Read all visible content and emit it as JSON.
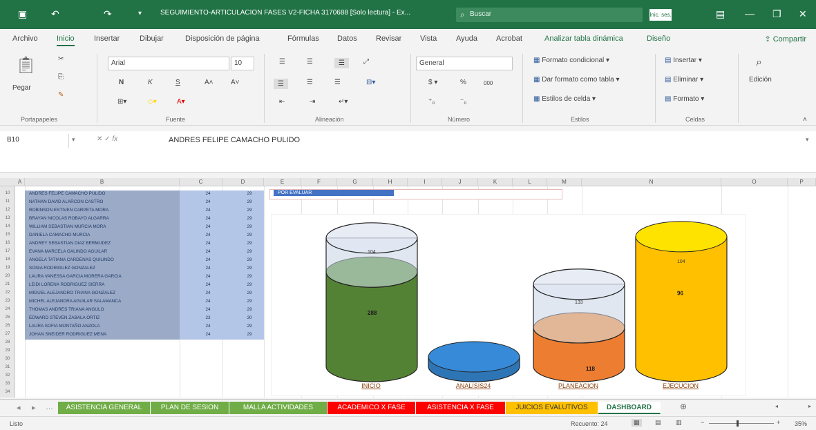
{
  "title_bar": {
    "doc_title": "SEGUIMIENTO-ARTICULACION FASES V2-FICHA 3170688 [Solo lectura] - Ex...",
    "search_placeholder": "Buscar",
    "signin": "Inic. ses."
  },
  "menu": [
    "Archivo",
    "Inicio",
    "Insertar",
    "Dibujar",
    "Disposición de página",
    "Fórmulas",
    "Datos",
    "Revisar",
    "Vista",
    "Ayuda",
    "Acrobat",
    "Analizar tabla dinámica",
    "Diseño"
  ],
  "share_label": "Compartir",
  "ribbon": {
    "clipboard": {
      "paste": "Pegar",
      "label": "Portapapeles"
    },
    "font": {
      "name": "Arial",
      "size": "10",
      "label": "Fuente"
    },
    "alignment": {
      "label": "Alineación"
    },
    "number": {
      "format": "General",
      "label": "Número"
    },
    "styles": {
      "conditional": "Formato condicional",
      "table": "Dar formato como tabla",
      "cell": "Estilos de celda",
      "label": "Estilos"
    },
    "cells": {
      "insert": "Insertar",
      "delete": "Eliminar",
      "format": "Formato",
      "label": "Celdas"
    },
    "editing": {
      "label": "Edición"
    }
  },
  "formula_bar": {
    "name_box": "B10",
    "value": "ANDRES FELIPE CAMACHO PULIDO"
  },
  "columns": [
    "A",
    "B",
    "C",
    "D",
    "E",
    "F",
    "G",
    "H",
    "I",
    "J",
    "K",
    "L",
    "M",
    "N",
    "O",
    "P"
  ],
  "row_numbers": [
    "10",
    "11",
    "12",
    "13",
    "14",
    "15",
    "16",
    "17",
    "18",
    "19",
    "20",
    "21",
    "22",
    "23",
    "24",
    "25",
    "26",
    "27",
    "28",
    "29",
    "30",
    "31",
    "32",
    "33",
    "34"
  ],
  "students": [
    {
      "name": "ANDRES FELIPE CAMACHO PULIDO",
      "c": "24",
      "d": "29"
    },
    {
      "name": "NATHAN DAVID ALARCON CASTRO",
      "c": "24",
      "d": "29"
    },
    {
      "name": "ROBINSON ESTIVEN CARPETA MORA",
      "c": "24",
      "d": "29"
    },
    {
      "name": "BRAYAN NICOLAS ROBAYO ALGARRA",
      "c": "24",
      "d": "29"
    },
    {
      "name": "WILLIAM SEBASTIAN MURCIA MORA",
      "c": "24",
      "d": "29"
    },
    {
      "name": "DANIELA CAMACHO MURCIA",
      "c": "24",
      "d": "29"
    },
    {
      "name": "ANDREY SEBASTIAN DIAZ BERMUDEZ",
      "c": "24",
      "d": "29"
    },
    {
      "name": "EVANA MARCELA GALINDO AGUILAR",
      "c": "24",
      "d": "29"
    },
    {
      "name": "ANGELA TATIANA CARDENAS QUILINDO",
      "c": "24",
      "d": "29"
    },
    {
      "name": "SONIA RODRIGUEZ GONZALEZ",
      "c": "24",
      "d": "29"
    },
    {
      "name": "LAURA VANESSA GARCIA MORERA GARCIA",
      "c": "24",
      "d": "29"
    },
    {
      "name": "LEIDI LORENA RODRIGUEZ SIERRA",
      "c": "24",
      "d": "29"
    },
    {
      "name": "MIGUEL ALEJANDRO TRIANA GONZALEZ",
      "c": "24",
      "d": "29"
    },
    {
      "name": "MICHEL ALEJANDRA AGUILAR SALAMANCA",
      "c": "24",
      "d": "29"
    },
    {
      "name": "THOMAS ANDRES TRIANA ANGULO",
      "c": "24",
      "d": "29"
    },
    {
      "name": "EDWARD STEVEN ZABALA ORTIZ",
      "c": "23",
      "d": "30"
    },
    {
      "name": "LAURA SOFIA MONTAÑO ANZOLA",
      "c": "24",
      "d": "29"
    },
    {
      "name": "JOHAN SNEIDER RODRIGUEZ MENA",
      "c": "24",
      "d": "29"
    }
  ],
  "pending_label": "POR EVALUAR",
  "chart_data": {
    "type": "bar",
    "style": "3d-cylinder",
    "categories": [
      "INICIO",
      "ANALISIS24",
      "PLANEACION",
      "EJECUCION"
    ],
    "series": [
      {
        "values": [
          288,
          0,
          118,
          396
        ],
        "colors": [
          "#548235",
          "#2e75b6",
          "#ed7d31",
          "#ffc000"
        ]
      },
      {
        "values": [
          104,
          0,
          133,
          0
        ]
      }
    ],
    "series_labels": [
      [
        "288",
        "",
        "118",
        "96"
      ],
      [
        "104",
        "",
        "133",
        "104"
      ]
    ],
    "ylim": [
      0,
      400
    ]
  },
  "sheet_tabs": [
    {
      "label": "ASISTENCIA GENERAL",
      "bg": "#70ad47",
      "fg": "#ffffff"
    },
    {
      "label": "PLAN DE SESION",
      "bg": "#70ad47",
      "fg": "#ffffff"
    },
    {
      "label": "MALLA ACTIVIDADES",
      "bg": "#70ad47",
      "fg": "#ffffff"
    },
    {
      "label": "ACADEMICO X FASE",
      "bg": "#ff0000",
      "fg": "#ffffff"
    },
    {
      "label": "ASISTENCIA X FASE",
      "bg": "#ff0000",
      "fg": "#ffffff"
    },
    {
      "label": "JUICIOS EVALUTIVOS",
      "bg": "#ffc000",
      "fg": "#333333"
    },
    {
      "label": "DASHBOARD",
      "bg": "#ffffff",
      "fg": "#217346"
    }
  ],
  "status": {
    "mode": "Listo",
    "count": "Recuento: 24",
    "zoom": "35%"
  }
}
